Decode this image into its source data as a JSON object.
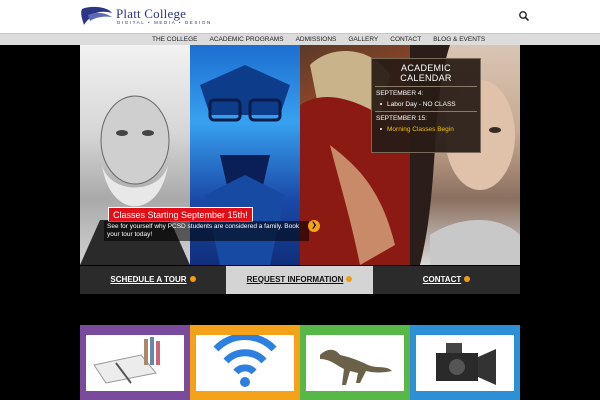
{
  "header": {
    "logo": {
      "title": "Platt College",
      "subtitle": "DIGITAL • MEDIA • DESIGN"
    }
  },
  "nav": {
    "items": [
      "THE COLLEGE",
      "ACADEMIC PROGRAMS",
      "ADMISSIONS",
      "GALLERY",
      "CONTACT",
      "BLOG & EVENTS"
    ]
  },
  "hero": {
    "calendar": {
      "title_line1": "ACADEMIC",
      "title_line2": "CALENDAR",
      "entries": [
        {
          "date": "SEPTEMBER 4:",
          "event": "Labor Day - NO CLASS"
        },
        {
          "date": "SEPTEMBER 15:",
          "event": "Morning Classes Begin"
        }
      ]
    },
    "banner": "Classes Starting September 15th!",
    "caption": "See for yourself why PCSD students are considered a family. Book your tour today!"
  },
  "cta": {
    "schedule": "SCHEDULE A TOUR",
    "request": "REQUEST INFORMATION",
    "contact": "CONTACT"
  },
  "icons": {
    "search": "search-icon",
    "next": "chevron-right-icon",
    "cta": "arrow-circle-icon"
  },
  "colors": {
    "brand": "#2b3583",
    "banner": "#e00e17",
    "accent": "#f3a21a",
    "tile_purple": "#7a4a9c",
    "tile_orange": "#f3a21a",
    "tile_green": "#57b847",
    "tile_blue": "#2d8fd6"
  }
}
